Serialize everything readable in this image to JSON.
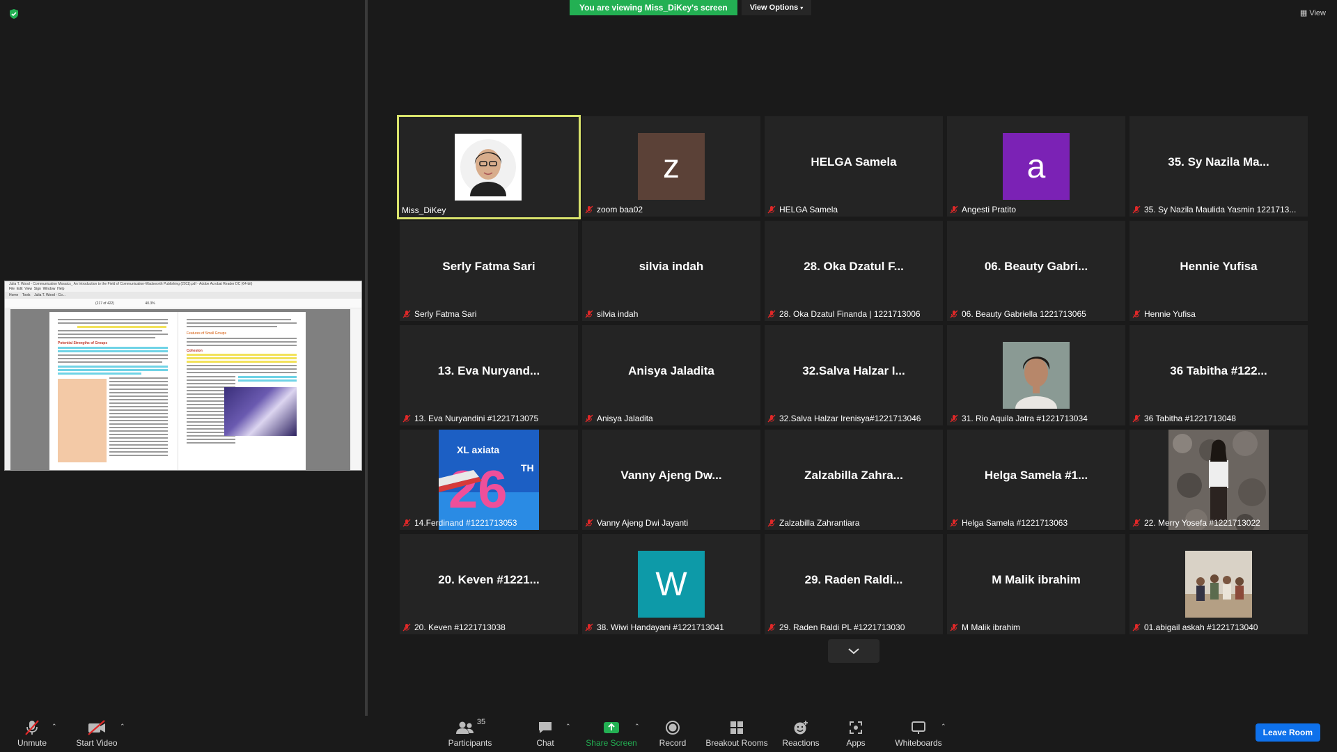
{
  "banner": {
    "viewing_text": "You are viewing Miss_DiKey's screen",
    "view_options": "View Options",
    "view_label": "View"
  },
  "shared_screen": {
    "title_text": "Julia T. Wood - Communication Mosaics_ An Introduction to the Field of Communication-Wadsworth Publishing (2011).pdf - Adobe Acrobat Reader DC (64-bit)",
    "menu": [
      "File",
      "Edit",
      "View",
      "Sign",
      "Window",
      "Help"
    ],
    "tabs": [
      "Home",
      "Tools",
      "Julia T. Wood - Co..."
    ],
    "page_indicator": "(217 of 422)",
    "zoom": "40.3%",
    "page_left_heading": "Potential Strengths of Groups",
    "page_right_heading": "Features of Small Groups",
    "page_right_sub": "Cohesion"
  },
  "tiles": [
    {
      "name": "Miss_DiKey",
      "label": "Miss_DiKey",
      "muted": false,
      "active": true,
      "type": "photo",
      "photo": "woman-glasses"
    },
    {
      "name": "zoom baa02",
      "label": "zoom baa02",
      "muted": true,
      "type": "letter",
      "letter": "z",
      "color": "#5b4137"
    },
    {
      "name": "HELGA Samela",
      "label": "HELGA Samela",
      "muted": true,
      "type": "text",
      "display": "HELGA Samela"
    },
    {
      "name": "Angesti Pratito",
      "label": "Angesti Pratito",
      "muted": true,
      "type": "letter",
      "letter": "a",
      "color": "#7b22b5"
    },
    {
      "name": "35. Sy Nazila Ma...",
      "label": "35. Sy Nazila Maulida Yasmin 1221713...",
      "muted": true,
      "type": "text",
      "display": "35. Sy Nazila Ma..."
    },
    {
      "name": "Serly Fatma Sari",
      "label": "Serly Fatma Sari",
      "muted": true,
      "type": "text",
      "display": "Serly Fatma Sari"
    },
    {
      "name": "silvia indah",
      "label": "silvia indah",
      "muted": true,
      "type": "text",
      "display": "silvia indah"
    },
    {
      "name": "28. Oka Dzatul F...",
      "label": "28. Oka Dzatul Finanda | 1221713006",
      "muted": true,
      "type": "text",
      "display": "28. Oka Dzatul F..."
    },
    {
      "name": "06. Beauty Gabri...",
      "label": "06. Beauty Gabriella 1221713065",
      "muted": true,
      "type": "text",
      "display": "06. Beauty Gabri..."
    },
    {
      "name": "Hennie Yufisa",
      "label": "Hennie Yufisa",
      "muted": true,
      "type": "text",
      "display": "Hennie Yufisa"
    },
    {
      "name": "13. Eva Nuryand...",
      "label": "13. Eva Nuryandini #1221713075",
      "muted": true,
      "type": "text",
      "display": "13. Eva Nuryand..."
    },
    {
      "name": "Anisya Jaladita",
      "label": "Anisya Jaladita",
      "muted": true,
      "type": "text",
      "display": "Anisya Jaladita"
    },
    {
      "name": "32.Salva Halzar I...",
      "label": "32.Salva Halzar Irenisya#1221713046",
      "muted": true,
      "type": "text",
      "display": "32.Salva Halzar I..."
    },
    {
      "name": "31. Rio Aquila Jatra",
      "label": "31. Rio Aquila Jatra #1221713034",
      "muted": true,
      "type": "photo",
      "photo": "young-man"
    },
    {
      "name": "36 Tabitha #122...",
      "label": "36 Tabitha #1221713048",
      "muted": true,
      "type": "text",
      "display": "36 Tabitha #122..."
    },
    {
      "name": "14.Ferdinand",
      "label": "14.Ferdinand #1221713053",
      "muted": true,
      "type": "photo",
      "photo": "xl-axiata-logo"
    },
    {
      "name": "Vanny Ajeng Dw...",
      "label": "Vanny Ajeng Dwi Jayanti",
      "muted": true,
      "type": "text",
      "display": "Vanny Ajeng Dw..."
    },
    {
      "name": "Zalzabilla Zahra...",
      "label": "Zalzabilla Zahrantiara",
      "muted": true,
      "type": "text",
      "display": "Zalzabilla  Zahra..."
    },
    {
      "name": "Helga Samela #1...",
      "label": "Helga Samela #1221713063",
      "muted": true,
      "type": "text",
      "display": "Helga Samela #1..."
    },
    {
      "name": "22. Merry Yosefa",
      "label": "22. Merry Yosefa #1221713022",
      "muted": true,
      "type": "photo",
      "photo": "woman-stone-wall"
    },
    {
      "name": "20. Keven #1221...",
      "label": "20. Keven #1221713038",
      "muted": true,
      "type": "text",
      "display": "20. Keven #1221..."
    },
    {
      "name": "38. Wiwi Handayani",
      "label": "38. Wiwi Handayani #1221713041",
      "muted": true,
      "type": "letter",
      "letter": "W",
      "color": "#0d9aa8"
    },
    {
      "name": "29. Raden Raldi...",
      "label": "29. Raden Raldi PL #1221713030",
      "muted": true,
      "type": "text",
      "display": "29. Raden Raldi..."
    },
    {
      "name": "M Malik ibrahim",
      "label": "M Malik ibrahim",
      "muted": true,
      "type": "text",
      "display": "M Malik ibrahim"
    },
    {
      "name": "01.abigail askah",
      "label": "01.abigail askah #1221713040",
      "muted": true,
      "type": "photo",
      "photo": "group-outdoors"
    }
  ],
  "logo": {
    "xl_text": "XL axiata",
    "number": "26",
    "suffix": "TH"
  },
  "toolbar": {
    "unmute": "Unmute",
    "start_video": "Start Video",
    "participants": "Participants",
    "participants_count": "35",
    "chat": "Chat",
    "share_screen": "Share Screen",
    "record": "Record",
    "breakout_rooms": "Breakout Rooms",
    "reactions": "Reactions",
    "apps": "Apps",
    "whiteboards": "Whiteboards",
    "leave": "Leave Room"
  },
  "colors": {
    "active_border": "#d9e36c",
    "banner_green": "#23b053",
    "share_green": "#23b053",
    "leave_blue": "#0e71eb",
    "muted_red": "#e02828"
  }
}
